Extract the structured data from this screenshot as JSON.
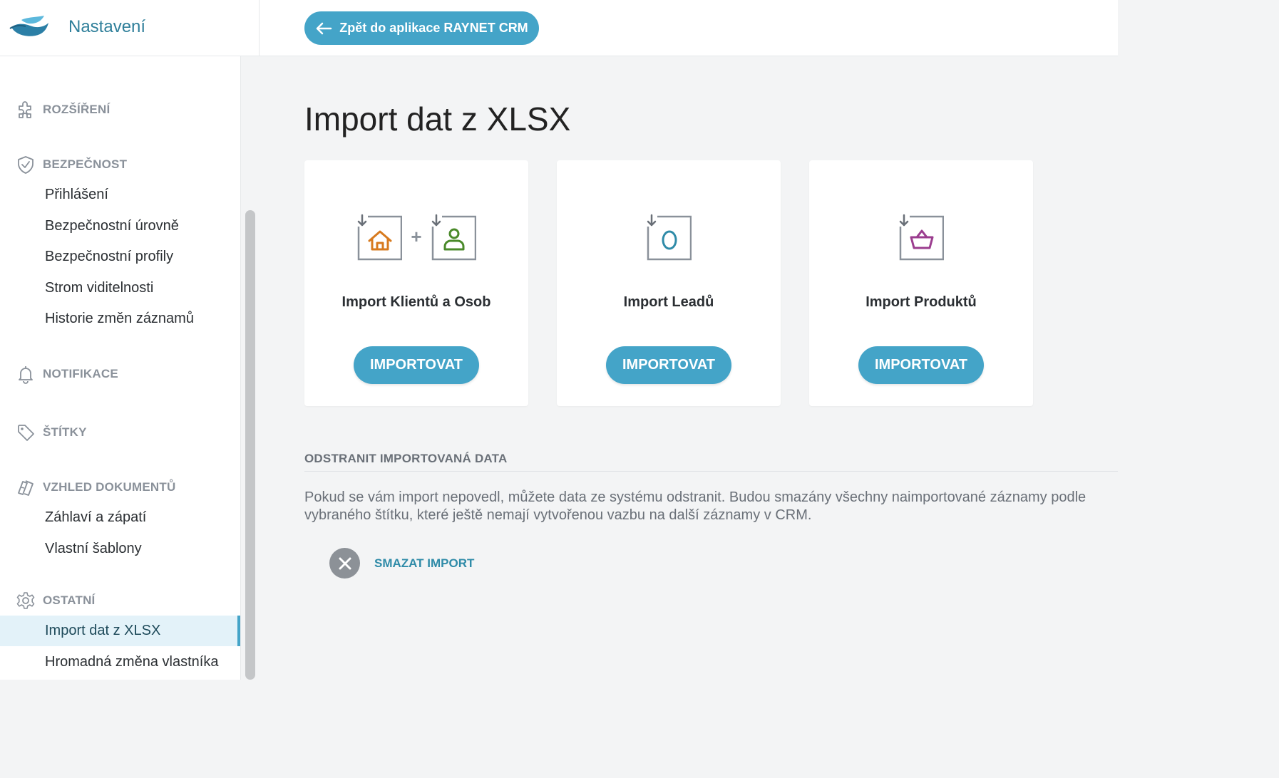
{
  "header": {
    "app_title": "Nastavení",
    "back_button_label": "Zpět do aplikace RAYNET CRM"
  },
  "sidebar": {
    "sections": [
      {
        "label": "ROZŠÍŘENÍ",
        "icon": "puzzle-icon"
      },
      {
        "label": "BEZPEČNOST",
        "icon": "shield-icon",
        "items": [
          "Přihlášení",
          "Bezpečnostní úrovně",
          "Bezpečnostní profily",
          "Strom viditelnosti",
          "Historie změn záznamů"
        ]
      },
      {
        "label": "NOTIFIKACE",
        "icon": "bell-icon"
      },
      {
        "label": "ŠTÍTKY",
        "icon": "tag-icon"
      },
      {
        "label": "VZHLED DOKUMENTŮ",
        "icon": "document-style-icon",
        "items": [
          "Záhlaví a zápatí",
          "Vlastní šablony"
        ]
      },
      {
        "label": "OSTATNÍ",
        "icon": "gear-icon",
        "items": [
          "Import dat z XLSX",
          "Hromadná změna vlastníka"
        ]
      }
    ],
    "active_item": "Import dat z XLSX"
  },
  "main": {
    "page_title": "Import dat z XLSX",
    "cards": [
      {
        "title": "Import Klientů a Osob",
        "button_label": "IMPORTOVAT"
      },
      {
        "title": "Import Leadů",
        "button_label": "IMPORTOVAT"
      },
      {
        "title": "Import Produktů",
        "button_label": "IMPORTOVAT"
      }
    ],
    "delete_section": {
      "heading": "ODSTRANIT IMPORTOVANÁ DATA",
      "description": "Pokud se vám import nepovedl, můžete data ze systému odstranit. Budou smazány všechny naimportované záznamy podle vybraného štítku, které ještě nemají vytvořenou vazbu na další záznamy v CRM.",
      "button_label": "SMAZAT IMPORT"
    }
  },
  "colors": {
    "accent": "#44a4c8",
    "company_icon": "#d77a1e",
    "person_icon": "#4a8a2a",
    "lead_icon": "#2f8ba8",
    "product_icon": "#9b3d8f"
  }
}
